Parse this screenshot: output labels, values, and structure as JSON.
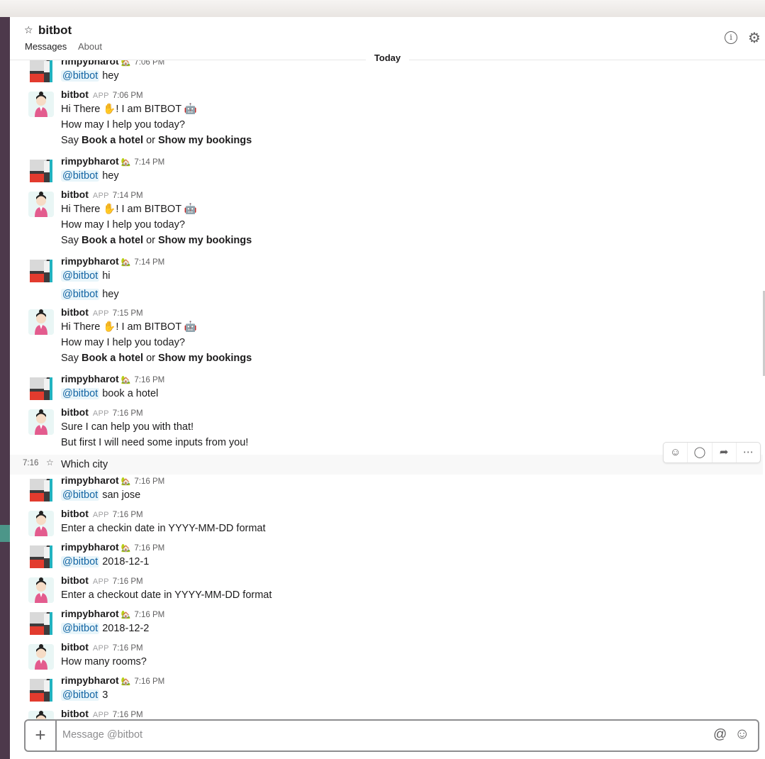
{
  "channel": {
    "name": "bitbot",
    "tabs": [
      "Messages",
      "About"
    ]
  },
  "day_divider": "Today",
  "composer": {
    "placeholder": "Message @bitbot"
  },
  "hover_row": {
    "time": "7:16"
  },
  "messages": [
    {
      "user": "rimpybharot",
      "type": "user",
      "time": "7:06 PM",
      "lines": [
        {
          "mention": "@bitbot",
          "text": "hey"
        }
      ]
    },
    {
      "user": "bitbot",
      "type": "bot",
      "badge": "APP",
      "time": "7:06 PM",
      "lines": [
        {
          "text": "Hi There ✋! I am BITBOT 🤖"
        },
        {
          "text": "How may I help you today?"
        },
        {
          "pre": "Say",
          "bold1": "Book a hotel",
          "mid": "or",
          "bold2": "Show my bookings"
        }
      ]
    },
    {
      "user": "rimpybharot",
      "type": "user",
      "time": "7:14 PM",
      "lines": [
        {
          "mention": "@bitbot",
          "text": "hey"
        }
      ]
    },
    {
      "user": "bitbot",
      "type": "bot",
      "badge": "APP",
      "time": "7:14 PM",
      "lines": [
        {
          "text": "Hi There ✋! I am BITBOT 🤖"
        },
        {
          "text": "How may I help you today?"
        },
        {
          "pre": "Say",
          "bold1": "Book a hotel",
          "mid": "or",
          "bold2": "Show my bookings"
        }
      ]
    },
    {
      "user": "rimpybharot",
      "type": "user",
      "time": "7:14 PM",
      "lines": [
        {
          "mention": "@bitbot",
          "text": "hi"
        },
        {
          "mention": "@bitbot",
          "text": "hey"
        }
      ]
    },
    {
      "user": "bitbot",
      "type": "bot",
      "badge": "APP",
      "time": "7:15 PM",
      "lines": [
        {
          "text": "Hi There ✋! I am BITBOT 🤖"
        },
        {
          "text": "How may I help you today?"
        },
        {
          "pre": "Say",
          "bold1": "Book a hotel",
          "mid": "or",
          "bold2": "Show my bookings"
        }
      ]
    },
    {
      "user": "rimpybharot",
      "type": "user",
      "time": "7:16 PM",
      "lines": [
        {
          "mention": "@bitbot",
          "text": "book a hotel"
        }
      ]
    },
    {
      "user": "bitbot",
      "type": "bot",
      "badge": "APP",
      "time": "7:16 PM",
      "lines": [
        {
          "text": "Sure I can help you with that!"
        },
        {
          "text": "But first I will need some inputs from you!"
        }
      ]
    },
    {
      "continuation": true,
      "lines": [
        {
          "text": "Which city"
        }
      ]
    },
    {
      "user": "rimpybharot",
      "type": "user",
      "time": "7:16 PM",
      "lines": [
        {
          "mention": "@bitbot",
          "text": "san jose"
        }
      ]
    },
    {
      "user": "bitbot",
      "type": "bot",
      "badge": "APP",
      "time": "7:16 PM",
      "lines": [
        {
          "text": "Enter a checkin date in YYYY-MM-DD format"
        }
      ]
    },
    {
      "user": "rimpybharot",
      "type": "user",
      "time": "7:16 PM",
      "lines": [
        {
          "mention": "@bitbot",
          "text": "2018-12-1"
        }
      ]
    },
    {
      "user": "bitbot",
      "type": "bot",
      "badge": "APP",
      "time": "7:16 PM",
      "lines": [
        {
          "text": "Enter a checkout date in YYYY-MM-DD format"
        }
      ]
    },
    {
      "user": "rimpybharot",
      "type": "user",
      "time": "7:16 PM",
      "lines": [
        {
          "mention": "@bitbot",
          "text": "2018-12-2"
        }
      ]
    },
    {
      "user": "bitbot",
      "type": "bot",
      "badge": "APP",
      "time": "7:16 PM",
      "lines": [
        {
          "text": "How many rooms?"
        }
      ]
    },
    {
      "user": "rimpybharot",
      "type": "user",
      "time": "7:16 PM",
      "lines": [
        {
          "mention": "@bitbot",
          "text": "3"
        }
      ]
    },
    {
      "user": "bitbot",
      "type": "bot",
      "badge": "APP",
      "time": "7:16 PM",
      "lines": []
    }
  ],
  "icons": {
    "star": "star-icon",
    "info": "info-icon",
    "settings": "gear-icon",
    "add": "plus-icon",
    "mention": "at-icon",
    "emoji": "emoji-icon",
    "status": "house-emoji"
  }
}
